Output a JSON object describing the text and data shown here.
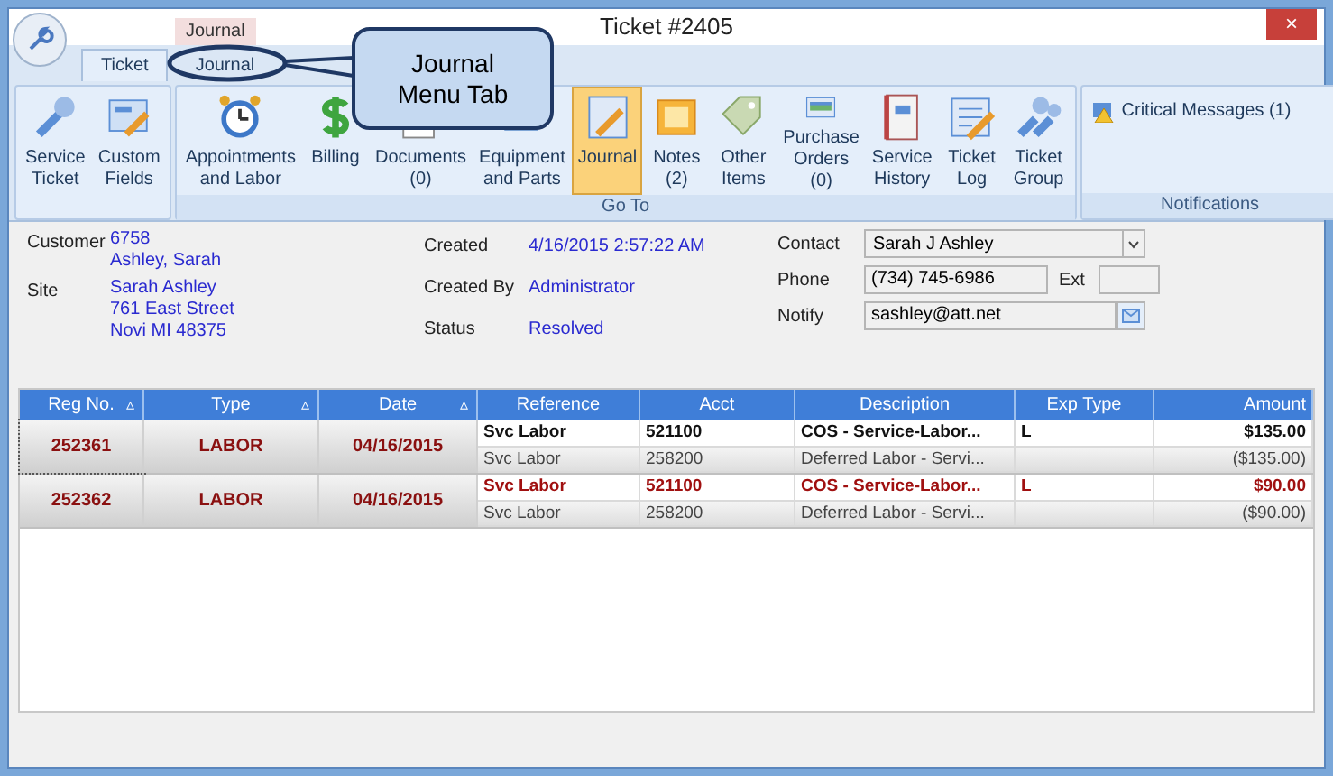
{
  "window": {
    "title": "Ticket #2405",
    "close": "×"
  },
  "contextual_tab_group": "Journal",
  "tabs": [
    {
      "label": "Ticket",
      "selected": true
    },
    {
      "label": "Journal",
      "selected": false
    }
  ],
  "ribbon": {
    "groups": [
      {
        "buttons": [
          {
            "label": "Service Ticket",
            "selected": false
          },
          {
            "label": "Custom Fields",
            "selected": false
          }
        ]
      },
      {
        "label": "Go To",
        "buttons": [
          {
            "label": "Appointments and Labor",
            "selected": false
          },
          {
            "label": "Billing",
            "selected": false
          },
          {
            "label": "Documents (0)",
            "selected": false
          },
          {
            "label": "Equipment and Parts",
            "selected": false
          },
          {
            "label": "Journal",
            "selected": true
          },
          {
            "label": "Notes (2)",
            "selected": false
          },
          {
            "label": "Other Items",
            "selected": false
          },
          {
            "label": "Purchase Orders (0)",
            "selected": false
          },
          {
            "label": "Service History",
            "selected": false
          },
          {
            "label": "Ticket Log",
            "selected": false
          },
          {
            "label": "Ticket Group",
            "selected": false
          }
        ]
      },
      {
        "label": "Notifications",
        "link": "Critical Messages (1)"
      }
    ]
  },
  "callout": {
    "text": "Journal Menu Tab"
  },
  "details": {
    "customer": {
      "label": "Customer",
      "lines": [
        "6758",
        "Ashley, Sarah"
      ]
    },
    "site": {
      "label": "Site",
      "lines": [
        "Sarah Ashley",
        "761 East Street",
        "Novi MI 48375"
      ]
    },
    "created": {
      "label": "Created",
      "value": "4/16/2015 2:57:22 AM"
    },
    "created_by": {
      "label": "Created By",
      "value": "Administrator"
    },
    "status": {
      "label": "Status",
      "value": "Resolved"
    },
    "contact": {
      "label": "Contact",
      "value": "Sarah J Ashley"
    },
    "phone": {
      "label": "Phone",
      "value": "(734) 745-6986"
    },
    "ext": {
      "label": "Ext"
    },
    "notify": {
      "label": "Notify",
      "value": "sashley@att.net"
    }
  },
  "table": {
    "columns": [
      {
        "label": "Reg No.",
        "sort": "▵"
      },
      {
        "label": "Type",
        "sort": "▵"
      },
      {
        "label": "Date",
        "sort": "▵"
      },
      {
        "label": "Reference"
      },
      {
        "label": "Acct"
      },
      {
        "label": "Description"
      },
      {
        "label": "Exp Type"
      },
      {
        "label": "Amount"
      }
    ],
    "rows": [
      {
        "reg_no": "252361",
        "type": "LABOR",
        "date": "04/16/2015",
        "selected": true,
        "lines": [
          {
            "reference": "Svc Labor",
            "acct": "521100",
            "description": "COS - Service-Labor...",
            "exp_type": "L",
            "amount": "$135.00",
            "kind": "debit"
          },
          {
            "reference": "Svc Labor",
            "acct": "258200",
            "description": "Deferred Labor - Servi...",
            "amount": "($135.00)",
            "kind": "credit"
          }
        ]
      },
      {
        "reg_no": "252362",
        "type": "LABOR",
        "date": "04/16/2015",
        "selected": false,
        "lines": [
          {
            "reference": "Svc Labor",
            "acct": "521100",
            "description": "COS - Service-Labor...",
            "exp_type": "L",
            "amount": "$90.00",
            "kind": "debit"
          },
          {
            "reference": "Svc Labor",
            "acct": "258200",
            "description": "Deferred Labor - Servi...",
            "amount": "($90.00)",
            "kind": "credit"
          }
        ]
      }
    ]
  }
}
